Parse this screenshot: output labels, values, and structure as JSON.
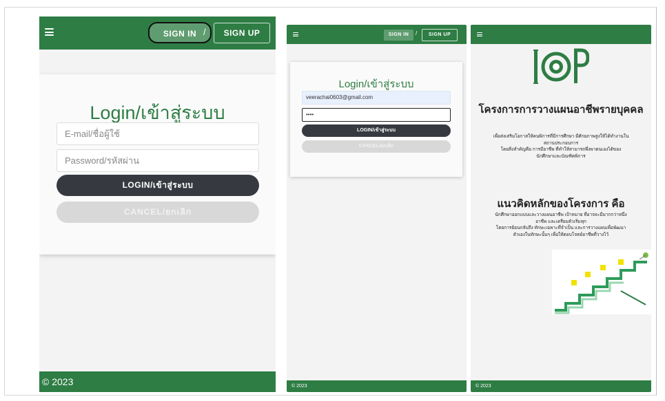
{
  "colors": {
    "brand_green": "#2e7d44",
    "dark_button": "#363a40",
    "light_button": "#d8d8d8"
  },
  "panel_desktop": {
    "menu_icon": "hamburger-icon",
    "nav": {
      "signin": "SIGN IN",
      "slash": "/",
      "signup": "SIGN UP"
    },
    "login": {
      "title": "Login/เข้าสู่ระบบ",
      "email_placeholder": "E-mail/ชื่อผู้ใช้",
      "password_placeholder": "Password/รหัสผ่าน",
      "login_button": "LOGIN/เข้าสู่ระบบ",
      "cancel_button": "CANCEL/ยกเลิก"
    },
    "footer": "© 2023"
  },
  "panel_mobile_login": {
    "menu_icon": "hamburger-icon",
    "nav": {
      "signin": "SIGN IN",
      "slash": "/",
      "signup": "SIGN UP"
    },
    "login": {
      "title": "Login/เข้าสู่ระบบ",
      "email_value": "veerachai0603@gmail.com",
      "password_value": "••••",
      "login_button": "LOGIN/เข้าสู่ระบบ",
      "cancel_button": "CANCEL/ยกเลิก"
    },
    "footer": "© 2023"
  },
  "panel_mobile_home": {
    "menu_icon": "hamburger-icon",
    "heading": "โครงการการวางแผนอาชีพรายบุคคล",
    "description": [
      "เพื่อส่งเสริมโอกาสให้คนพิการที่มีการศึกษา มีศักยภาพสูงให้ได้ทำงานใน",
      "สถานประกอบการ",
      "โดยสิ่งสำคัญคือ การมีอาชีพ ที่ทำให้สามารถพึ่งพาตนเองได้ของ",
      "นักศึกษาและบัณฑิตพิการ"
    ],
    "concept_heading": "แนวคิดหลักของโครงการ คือ",
    "concept_description": [
      "นักศึกษาออกแบบและวางแผนอาชีพ เป้าหมาย ที่อาจจะมีมากกว่าหนึ่ง",
      "อาชีพ และเตรียมตัวเริ่มทุก",
      "โดยการย้อนกลับถึง ทักษะเฉพาะที่จำเป็น และการวางแผนเพื่อพัฒนา",
      "ตัวเองในทักษะนั้นๆ เพื่อให้ตอบโจทย์อาชีพที่วางไว้"
    ],
    "footer": "© 2023"
  }
}
